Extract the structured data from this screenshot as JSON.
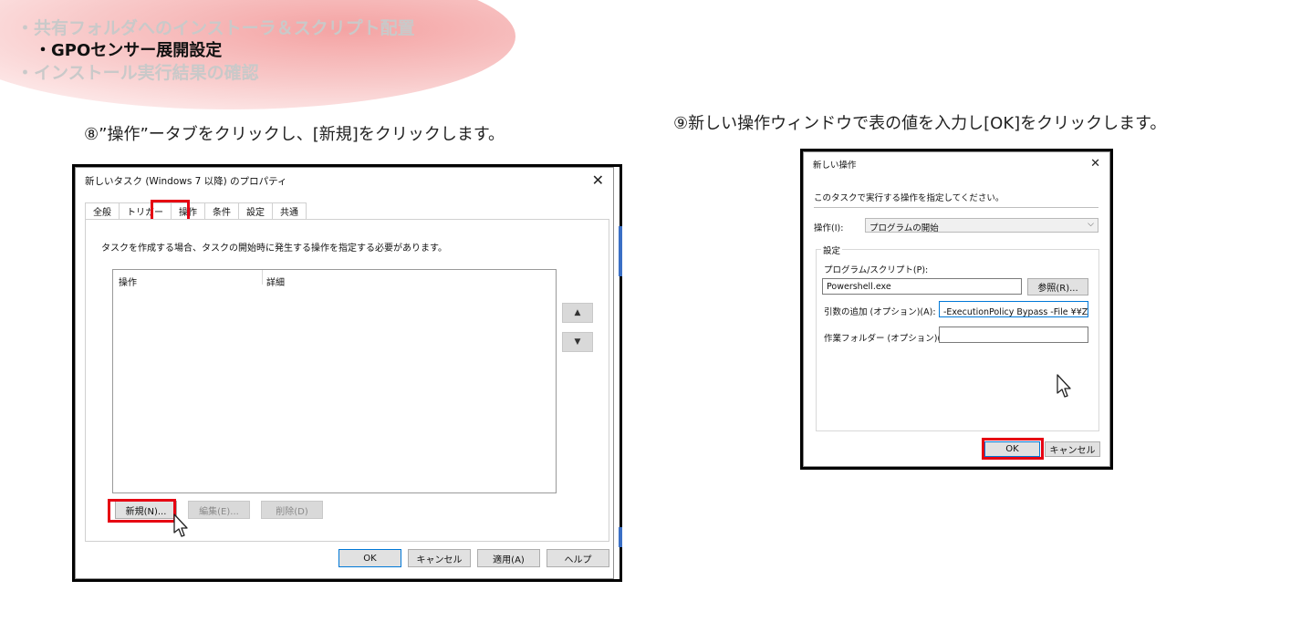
{
  "header": {
    "nav_items": [
      {
        "label": "・共有フォルダへのインストーラ＆スクリプト配置",
        "active": false
      },
      {
        "label": "・GPOセンサー展開設定",
        "active": true
      },
      {
        "label": "・インストール実行結果の確認",
        "active": false
      }
    ]
  },
  "captions": {
    "step8": "⑧”操作”ータブをクリックし、[新規]をクリックします。",
    "step9": "⑨新しい操作ウィンドウで表の値を入力し[OK]をクリックします。"
  },
  "task_dialog": {
    "title": "新しいタスク (Windows 7 以降) のプロパティ",
    "tabs": [
      "全般",
      "トリガー",
      "操作",
      "条件",
      "設定",
      "共通"
    ],
    "selected_tab": "操作",
    "instruction": "タスクを作成する場合、タスクの開始時に発生する操作を指定する必要があります。",
    "columns": [
      "操作",
      "詳細"
    ],
    "move_up": "▲",
    "move_down": "▼",
    "new_button": "新規(N)...",
    "edit_button": "編集(E)...",
    "delete_button": "削除(D)",
    "ok_button": "OK",
    "cancel_button": "キャンセル",
    "apply_button": "適用(A)",
    "help_button": "ヘルプ"
  },
  "action_dialog": {
    "title": "新しい操作",
    "instruction": "このタスクで実行する操作を指定してください。",
    "action_label": "操作(I):",
    "action_value": "プログラムの開始",
    "settings_group": "設定",
    "program_label": "プログラム/スクリプト(P):",
    "program_value": "Powershell.exe",
    "browse_button": "参照(R)...",
    "args_label": "引数の追加 (オプション)(A):",
    "args_value": "-ExecutionPolicy Bypass -File ¥¥ZAWA-検証",
    "workdir_label": "作業フォルダー (オプション)(T):",
    "workdir_value": "",
    "ok_button": "OK",
    "cancel_button": "キャンセル"
  },
  "colors": {
    "highlight": "#e60012",
    "accent": "#0078d7",
    "nav_inactive": "#c9c9c9"
  },
  "icons": [
    "close-icon",
    "mouse-pointer-icon",
    "chevron-down-icon",
    "move-up-icon",
    "move-down-icon"
  ]
}
